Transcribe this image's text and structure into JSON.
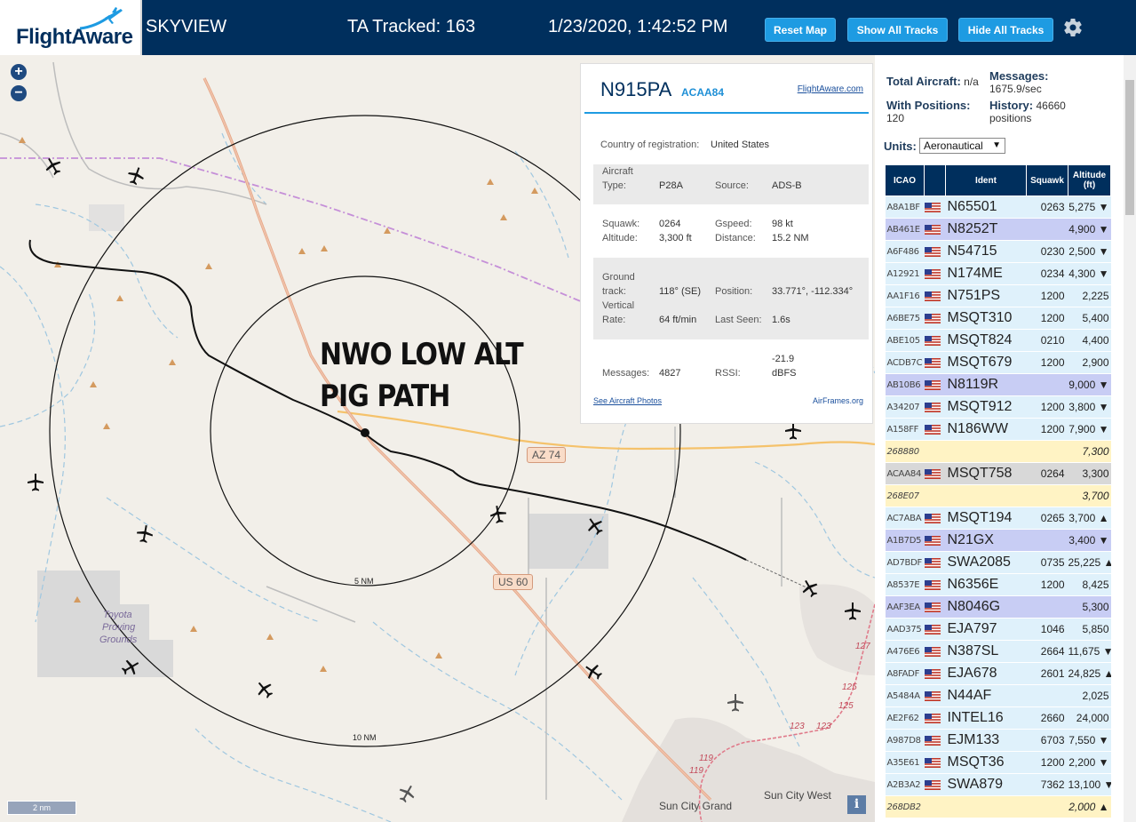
{
  "header": {
    "logo_text": "FlightAware",
    "app_name": "SKYVIEW",
    "tracked": "TA Tracked: 163",
    "datetime": "1/23/2020, 1:42:52 PM",
    "buttons": {
      "reset": "Reset Map",
      "show": "Show All Tracks",
      "hide": "Hide All Tracks"
    }
  },
  "map": {
    "zoom_in": "+",
    "zoom_out": "−",
    "annotation_line1": "NWO LOW ALT",
    "annotation_line2": "PIG PATH",
    "shields": {
      "az74": "AZ 74",
      "us60": "US 60"
    },
    "labels": {
      "toyota_line1": "Toyota",
      "toyota_line2": "Proving",
      "toyota_line3": "Grounds",
      "sun_city_grand": "Sun City Grand",
      "sun_city_west": "Sun City West"
    },
    "ring_labels": {
      "inner": "5 NM",
      "outer": "10 NM"
    },
    "road_numbers": [
      "127",
      "125",
      "125",
      "123",
      "123",
      "119",
      "119"
    ],
    "scale": "2 nm",
    "info": "i"
  },
  "popup": {
    "ident": "N915PA",
    "hex": "ACAA84",
    "fa_link": "FlightAware.com",
    "country_label": "Country of registration:",
    "country_value": "United States",
    "aircraft_type_label_1": "Aircraft",
    "aircraft_type_label_2": "Type:",
    "aircraft_type_value": "P28A",
    "source_label": "Source:",
    "source_value": "ADS-B",
    "squawk_label": "Squawk:",
    "squawk_value": "0264",
    "altitude_label": "Altitude:",
    "altitude_value": "3,300 ft",
    "gspeed_label": "Gspeed:",
    "gspeed_value": "98 kt",
    "distance_label": "Distance:",
    "distance_value": "15.2 NM",
    "track_label_1": "Ground",
    "track_label_2": "track:",
    "track_value": "118° (SE)",
    "position_label": "Position:",
    "position_value": "33.771°, -112.334°",
    "vrate_label_1": "Vertical",
    "vrate_label_2": "Rate:",
    "vrate_value": "64 ft/min",
    "lastseen_label": "Last Seen:",
    "lastseen_value": "1.6s",
    "messages_label": "Messages:",
    "messages_value": "4827",
    "rssi_label": "RSSI:",
    "rssi_value_1": "-21.9",
    "rssi_value_2": "dBFS",
    "photos_link": "See Aircraft Photos",
    "airframes_link": "AirFrames.org"
  },
  "sidebar": {
    "total_label": "Total Aircraft:",
    "total_value": "n/a",
    "messages_label": "Messages:",
    "messages_value": "1675.9/sec",
    "positions_label": "With Positions:",
    "positions_value": "120",
    "history_label": "History:",
    "history_value_1": "46660",
    "history_value_2": "positions",
    "units_label": "Units:",
    "units_value": "Aeronautical",
    "table_headers": {
      "icao": "ICAO",
      "ident": "Ident",
      "squawk": "Squawk",
      "alt1": "Altitude",
      "alt2": "(ft)"
    },
    "rows": [
      {
        "icao": "A8A1BF",
        "ident": "N65501",
        "squawk": "0263",
        "alt": "5,275 ▼",
        "color": "blue"
      },
      {
        "icao": "AB461E",
        "ident": "N8252T",
        "squawk": "",
        "alt": "4,900 ▼",
        "color": "lav"
      },
      {
        "icao": "A6F486",
        "ident": "N54715",
        "squawk": "0230",
        "alt": "2,500 ▼",
        "color": "blue"
      },
      {
        "icao": "A12921",
        "ident": "N174ME",
        "squawk": "0234",
        "alt": "4,300 ▼",
        "color": "blue"
      },
      {
        "icao": "AA1F16",
        "ident": "N751PS",
        "squawk": "1200",
        "alt": "2,225",
        "color": "blue"
      },
      {
        "icao": "A6BE75",
        "ident": "MSQT310",
        "squawk": "1200",
        "alt": "5,400",
        "color": "blue"
      },
      {
        "icao": "ABE105",
        "ident": "MSQT824",
        "squawk": "0210",
        "alt": "4,400",
        "color": "blue"
      },
      {
        "icao": "ACDB7C",
        "ident": "MSQT679",
        "squawk": "1200",
        "alt": "2,900",
        "color": "blue"
      },
      {
        "icao": "AB10B6",
        "ident": "N8119R",
        "squawk": "",
        "alt": "9,000 ▼",
        "color": "lav"
      },
      {
        "icao": "A34207",
        "ident": "MSQT912",
        "squawk": "1200",
        "alt": "3,800 ▼",
        "color": "blue"
      },
      {
        "icao": "A158FF",
        "ident": "N186WW",
        "squawk": "1200",
        "alt": "7,900 ▼",
        "color": "blue"
      },
      {
        "icao": "268880",
        "ident": "",
        "squawk": "",
        "alt": "7,300",
        "color": "yel"
      },
      {
        "icao": "ACAA84",
        "ident": "MSQT758",
        "squawk": "0264",
        "alt": "3,300",
        "color": "sel"
      },
      {
        "icao": "268E07",
        "ident": "",
        "squawk": "",
        "alt": "3,700",
        "color": "yel"
      },
      {
        "icao": "AC7ABA",
        "ident": "MSQT194",
        "squawk": "0265",
        "alt": "3,700 ▲",
        "color": "blue"
      },
      {
        "icao": "A1B7D5",
        "ident": "N21GX",
        "squawk": "",
        "alt": "3,400 ▼",
        "color": "lav"
      },
      {
        "icao": "AD7BDF",
        "ident": "SWA2085",
        "squawk": "0735",
        "alt": "25,225 ▲",
        "color": "blue"
      },
      {
        "icao": "A8537E",
        "ident": "N6356E",
        "squawk": "1200",
        "alt": "8,425",
        "color": "blue"
      },
      {
        "icao": "AAF3EA",
        "ident": "N8046G",
        "squawk": "",
        "alt": "5,300",
        "color": "lav"
      },
      {
        "icao": "AAD375",
        "ident": "EJA797",
        "squawk": "1046",
        "alt": "5,850",
        "color": "blue"
      },
      {
        "icao": "A476E6",
        "ident": "N387SL",
        "squawk": "2664",
        "alt": "11,675 ▼",
        "color": "blue"
      },
      {
        "icao": "A8FADF",
        "ident": "EJA678",
        "squawk": "2601",
        "alt": "24,825 ▲",
        "color": "blue"
      },
      {
        "icao": "A5484A",
        "ident": "N44AF",
        "squawk": "",
        "alt": "2,025",
        "color": "blue"
      },
      {
        "icao": "AE2F62",
        "ident": "INTEL16",
        "squawk": "2660",
        "alt": "24,000",
        "color": "blue"
      },
      {
        "icao": "A987D8",
        "ident": "EJM133",
        "squawk": "6703",
        "alt": "7,550 ▼",
        "color": "blue"
      },
      {
        "icao": "A35E61",
        "ident": "MSQT36",
        "squawk": "1200",
        "alt": "2,200 ▼",
        "color": "blue"
      },
      {
        "icao": "A2B3A2",
        "ident": "SWA879",
        "squawk": "7362",
        "alt": "13,100 ▼",
        "color": "blue"
      },
      {
        "icao": "268DB2",
        "ident": "",
        "squawk": "",
        "alt": "2,000 ▲",
        "color": "yel"
      }
    ]
  },
  "colors": {
    "header_bg": "#002f5d",
    "button_bg": "#1e9be2",
    "row_blue": "#dff1fb",
    "row_lavender": "#c8cdf4",
    "row_yellow": "#fff3c4",
    "row_selected": "#d8d8d8"
  }
}
